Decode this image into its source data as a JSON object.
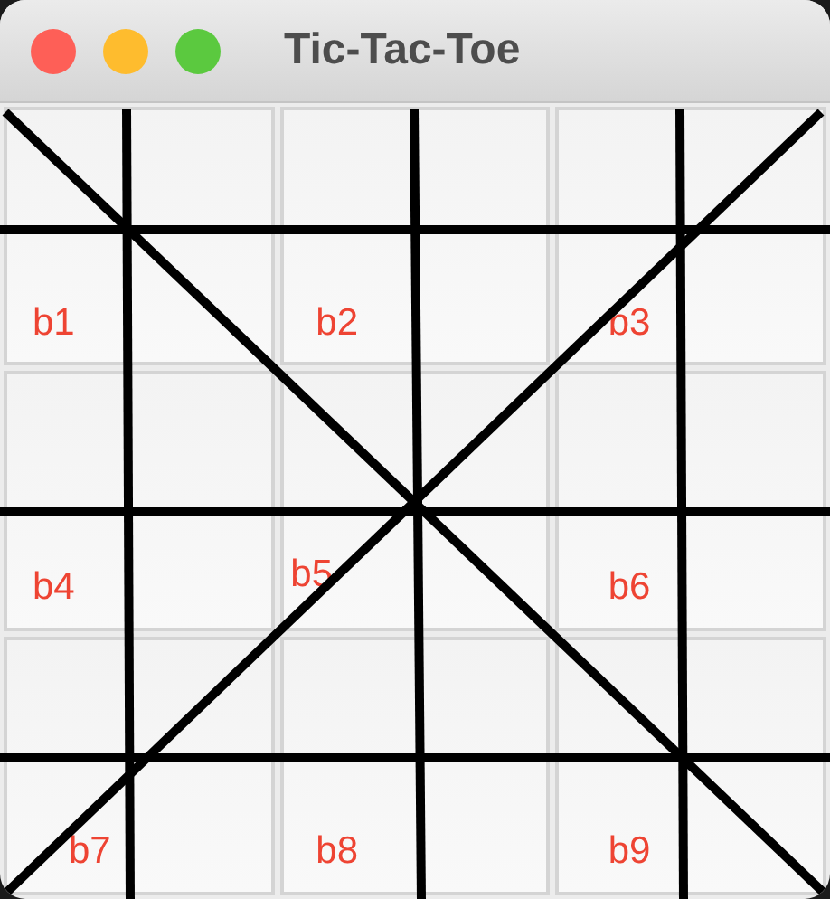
{
  "window": {
    "title": "Tic-Tac-Toe"
  },
  "buttons": [
    {
      "label": "b1"
    },
    {
      "label": "b2"
    },
    {
      "label": "b3"
    },
    {
      "label": "b4"
    },
    {
      "label": "b5"
    },
    {
      "label": "b6"
    },
    {
      "label": "b7"
    },
    {
      "label": "b8"
    },
    {
      "label": "b9"
    }
  ]
}
